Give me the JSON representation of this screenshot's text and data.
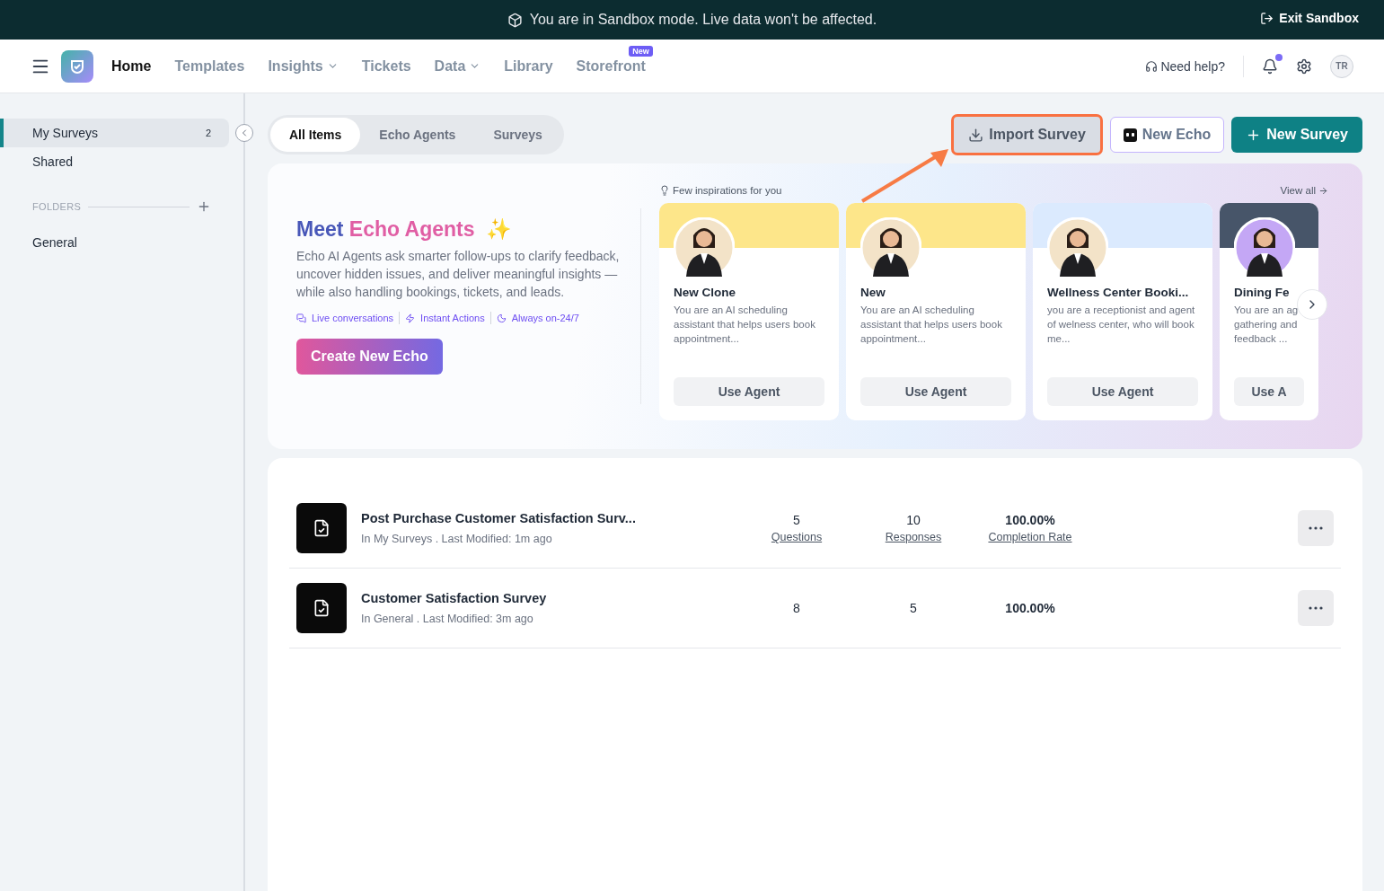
{
  "banner": {
    "message": "You are in Sandbox mode. Live data won't be affected.",
    "exit": "Exit Sandbox"
  },
  "nav": {
    "items": [
      {
        "label": "Home",
        "selected": true,
        "dropdown": false
      },
      {
        "label": "Templates",
        "selected": false,
        "dropdown": false
      },
      {
        "label": "Insights",
        "selected": false,
        "dropdown": true
      },
      {
        "label": "Tickets",
        "selected": false,
        "dropdown": false
      },
      {
        "label": "Data",
        "selected": false,
        "dropdown": true
      },
      {
        "label": "Library",
        "selected": false,
        "dropdown": false
      },
      {
        "label": "Storefront",
        "selected": false,
        "dropdown": false,
        "badge": "New"
      }
    ],
    "help": "Need help?",
    "notification_dot": true,
    "avatar": "TR"
  },
  "sidebar": {
    "items": [
      {
        "label": "My Surveys",
        "count": "2",
        "selected": true
      },
      {
        "label": "Shared",
        "selected": false
      }
    ],
    "folders_heading": "FOLDERS",
    "folders": [
      {
        "label": "General",
        "selected": false
      }
    ]
  },
  "tabs": [
    {
      "label": "All Items",
      "selected": true
    },
    {
      "label": "Echo Agents",
      "selected": false
    },
    {
      "label": "Surveys",
      "selected": false
    }
  ],
  "actions": {
    "import": "Import Survey",
    "new_echo": "New Echo",
    "new_survey": "New Survey"
  },
  "promo": {
    "title_part1": "Meet",
    "title_part2": "Echo Agents",
    "sparkle": "✨",
    "description": "Echo AI Agents ask smarter follow-ups to clarify feedback, uncover hidden issues, and deliver meaningful insights — while also handling bookings, tickets, and leads.",
    "features": [
      "Live conversations",
      "Instant Actions",
      "Always on-24/7"
    ],
    "cta": "Create New Echo",
    "inspirations_label": "Few inspirations for you",
    "view_all": "View all",
    "agents": [
      {
        "name": "New Clone",
        "description": "You are an AI scheduling assistant that helps users book appointment...",
        "button": "Use Agent",
        "color": "#fde68a"
      },
      {
        "name": "New",
        "description": "You are an AI scheduling assistant that helps users book appointment...",
        "button": "Use Agent",
        "color": "#fde68a"
      },
      {
        "name": "Wellness Center Booki...",
        "description": "you are a receptionist and agent of welness center, who will book me...",
        "button": "Use Agent",
        "color": "#dbeafe"
      },
      {
        "name": "Dining Fe",
        "description": "You are an ag gathering and feedback ...",
        "button": "Use A",
        "color": "#475569"
      }
    ]
  },
  "surveys": [
    {
      "title": "Post Purchase Customer Satisfaction Surv...",
      "meta": "In My Surveys . Last Modified: 1m ago",
      "questions": "5",
      "questions_label": "Questions",
      "responses": "10",
      "responses_label": "Responses",
      "rate": "100.00%",
      "rate_label": "Completion Rate"
    },
    {
      "title": "Customer Satisfaction Survey",
      "meta": "In General . Last Modified: 3m ago",
      "questions": "8",
      "responses": "5",
      "rate": "100.00%"
    }
  ]
}
